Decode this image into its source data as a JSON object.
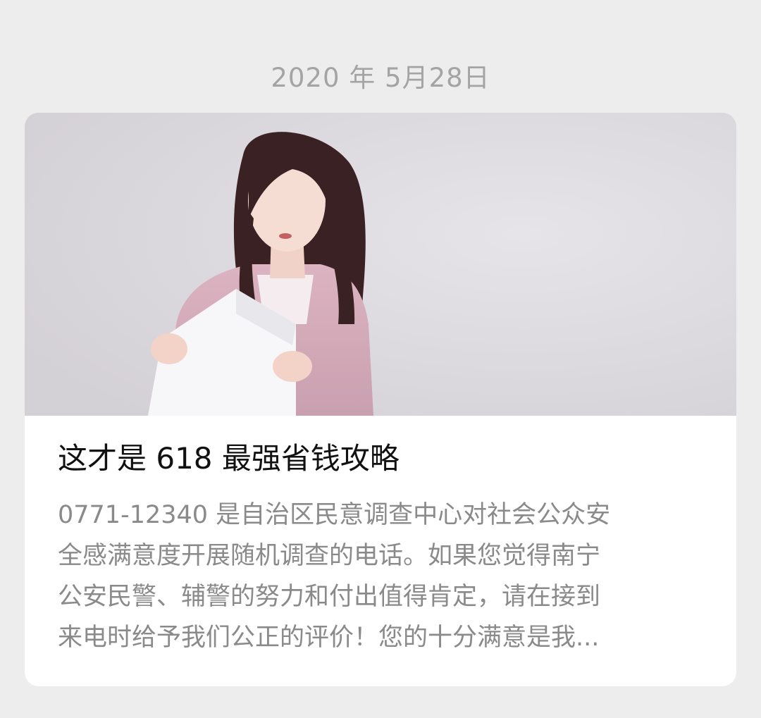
{
  "date": "2020 年 5月28日",
  "article": {
    "title": "这才是 618 最强省钱攻略",
    "summary_lines": [
      "0771-12340 是自治区民意调查中心对社会公众安",
      "全感满意度开展随机调查的电话。如果您觉得南宁",
      "公安民警、辅警的努力和付出值得肯定，请在接到",
      "来电时给予我们公正的评价！您的十分满意是我..."
    ]
  },
  "colors": {
    "background": "#ededed",
    "card": "#ffffff",
    "date_text": "#a4a4a4",
    "title_text": "#111111",
    "summary_text": "#8a8a8a"
  }
}
